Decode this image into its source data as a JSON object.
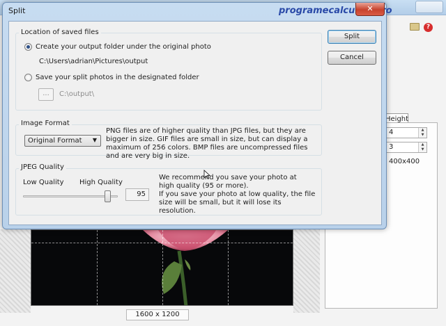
{
  "background": {
    "tab_height_label": "Height",
    "spin_rows": "4",
    "spin_cols": "3",
    "piece_size": "400x400",
    "photo_size": "1600 x 1200"
  },
  "dialog": {
    "title": "Split",
    "watermark": "programecalculator.ro",
    "close_label": "✕",
    "location": {
      "group_label": "Location of saved files",
      "option_original": "Create your output folder under the original photo",
      "original_path": "C:\\Users\\adrian\\Pictures\\output",
      "option_designated": "Save your split photos in the designated folder",
      "browse_label": "...",
      "designated_path": "C:\\output\\"
    },
    "format": {
      "group_label": "Image Format",
      "selected": "Original Format",
      "note": "PNG files are of higher quality than JPG files, but they are bigger in size. GIF files are small in size, but can display a maximum of 256 colors. BMP files are uncompressed files and are very big in size."
    },
    "jpeg": {
      "group_label": "JPEG Quality",
      "low_label": "Low Quality",
      "high_label": "High Quality",
      "quality_value": "95",
      "slider_level_percent": 95,
      "note_line1": "We recommend you save your photo at high quality (95 or more).",
      "note_line2": "If you save your photo at low quality, the file size will be small, but it will lose its resolution."
    },
    "split_button": "Split",
    "cancel_button": "Cancel"
  }
}
